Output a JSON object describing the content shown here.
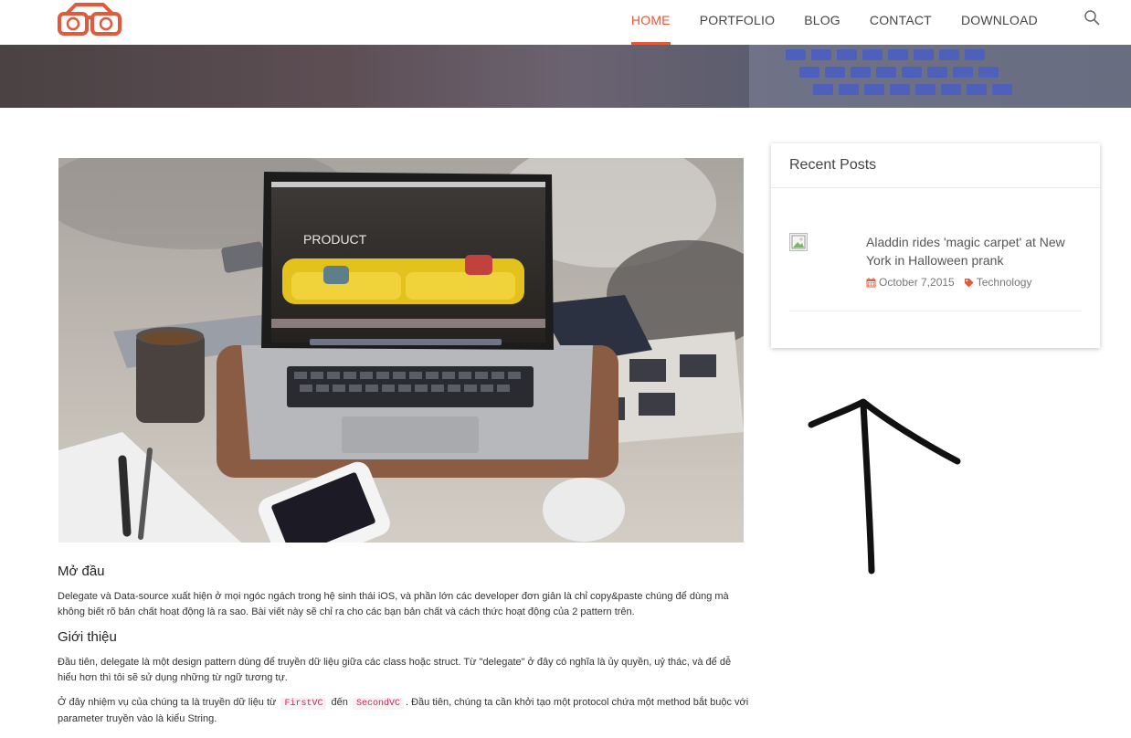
{
  "nav": {
    "items": [
      {
        "label": "HOME",
        "active": true
      },
      {
        "label": "PORTFOLIO",
        "active": false
      },
      {
        "label": "BLOG",
        "active": false
      },
      {
        "label": "CONTACT",
        "active": false
      },
      {
        "label": "DOWNLOAD",
        "active": false
      }
    ],
    "search_icon": "magnifier-icon",
    "accent_color": "#e05a3c"
  },
  "feature": {
    "screen_text": "PRODUCT"
  },
  "article": {
    "intro_heading": "Mở đầu",
    "intro_text": "Delegate và Data-source xuất hiện ở mọi ngóc ngách trong hệ sinh thái iOS, và phần lớn các developer đơn giản là chỉ copy&paste chúng để dùng mà không biết rõ bản chất hoạt động là ra sao. Bài viết này sẽ chỉ ra cho các bạn bản chất và cách thức hoạt động của 2 pattern trên.",
    "section_heading": "Giới thiệu",
    "section_text": "Đầu tiên, delegate là một design pattern dùng để truyền dữ liệu giữa các class hoặc struct. Từ \"delegate\" ở đây có nghĩa là ủy quyền, uỷ thác, và để dễ hiểu hơn thì tôi sẽ sử dụng những từ ngữ tương tự.",
    "task_before": "Ở đây nhiệm vụ của chúng ta là truyền dữ liệu từ",
    "task_code1": "FirstVC",
    "task_mid": "đến",
    "task_code2": "SecondVC",
    "task_after": ". Đầu tiên, chúng ta cần khởi tạo một protocol chứa một method bắt buộc với parameter truyền vào là kiểu String."
  },
  "sidebar": {
    "widget_title": "Recent Posts",
    "post": {
      "title": "Aladdin rides 'magic carpet' at New York in Halloween prank",
      "date": "October 7,2015",
      "category": "Technology",
      "date_icon": "calendar-icon",
      "category_icon": "tag-icon",
      "icon_color": "#e05a3c"
    }
  }
}
